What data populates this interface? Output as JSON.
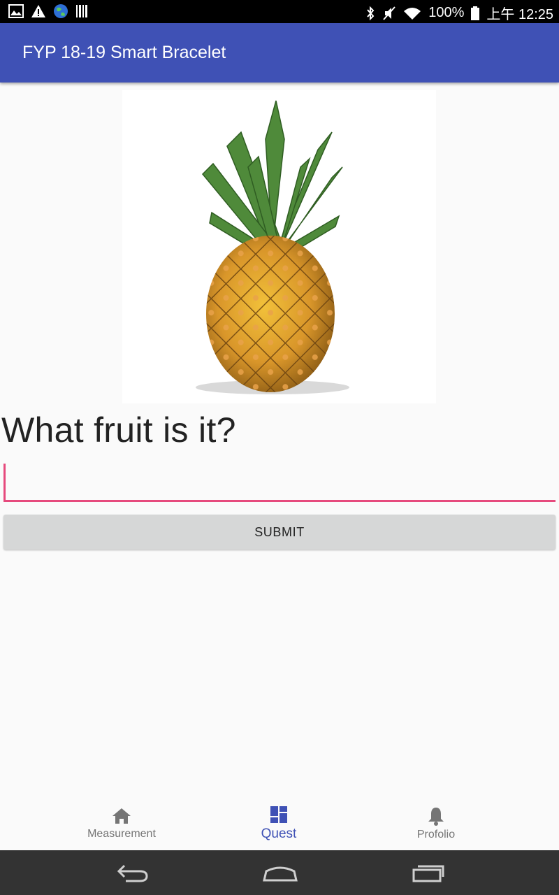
{
  "status_bar": {
    "battery": "100%",
    "time": "上午 12:25"
  },
  "app": {
    "title": "FYP 18-19 Smart Bracelet"
  },
  "quest": {
    "image_alt": "pineapple",
    "question": "What fruit is it?",
    "answer_value": "",
    "submit_label": "SUBMIT"
  },
  "bottom_nav": {
    "items": [
      {
        "label": "Measurement",
        "icon": "home-icon"
      },
      {
        "label": "Quest",
        "icon": "dashboard-icon",
        "active": true
      },
      {
        "label": "Profolio",
        "icon": "bell-icon"
      }
    ]
  },
  "colors": {
    "app_bar": "#3f51b5",
    "accent": "#e64a7d",
    "active_nav": "#3f51b5",
    "system_nav": "#333333"
  }
}
